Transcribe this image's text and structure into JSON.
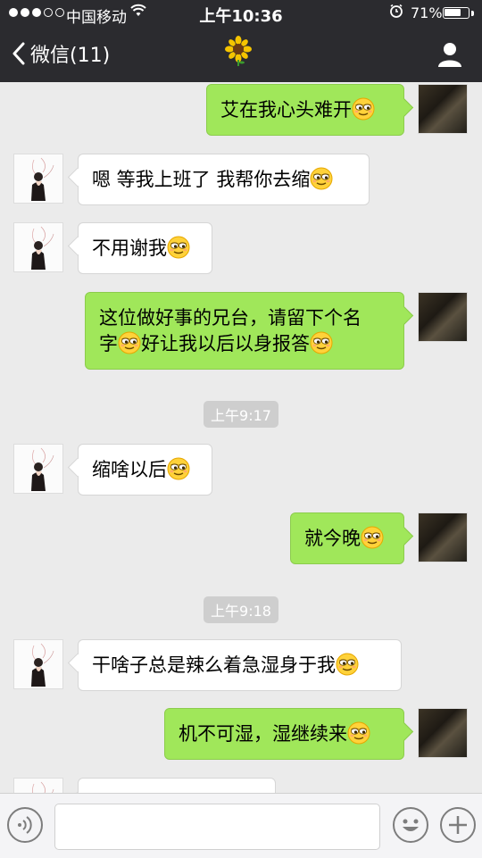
{
  "status_bar": {
    "carrier": "中国移动",
    "time": "上午10:36",
    "battery": "71%",
    "battery_level": 0.71
  },
  "nav": {
    "back_label": "微信(11)",
    "title_icon": "sunflower-emoji",
    "title": "🌻",
    "right_icon": "contact-icon"
  },
  "messages": [
    {
      "side": "self",
      "text": "艾在我心头难开",
      "emoji": "smirk-emoji"
    },
    {
      "side": "other",
      "text": "嗯 等我上班了 我帮你去缩",
      "emoji": "smirk-emoji"
    },
    {
      "side": "other",
      "text": "不用谢我",
      "emoji": "smirk-emoji"
    },
    {
      "side": "self",
      "line1": "这位做好事的兄台，请留下个名",
      "line2a": "字",
      "line2b": "好让我以后以身报答",
      "emoji": "smirk-emoji"
    },
    {
      "type": "timestamp",
      "text": "上午9:17"
    },
    {
      "side": "other",
      "text": "缩啥以后",
      "emoji": "smirk-emoji"
    },
    {
      "side": "self",
      "text": "就今晚",
      "emoji": "smirk-emoji"
    },
    {
      "type": "timestamp",
      "text": "上午9:18"
    },
    {
      "side": "other",
      "text": "干啥子总是辣么着急湿身于我",
      "emoji": "smirk-emoji"
    },
    {
      "side": "self",
      "text": "机不可湿，湿继续来",
      "emoji": "smirk-emoji"
    }
  ],
  "input_bar": {
    "voice_icon": "voice-icon",
    "emoji_icon": "emoji-icon",
    "plus_icon": "plus-icon"
  },
  "colors": {
    "nav_bg": "#2b2b2f",
    "chat_bg": "#ebebeb",
    "self_bubble": "#a0e75a",
    "other_bubble": "#ffffff"
  }
}
